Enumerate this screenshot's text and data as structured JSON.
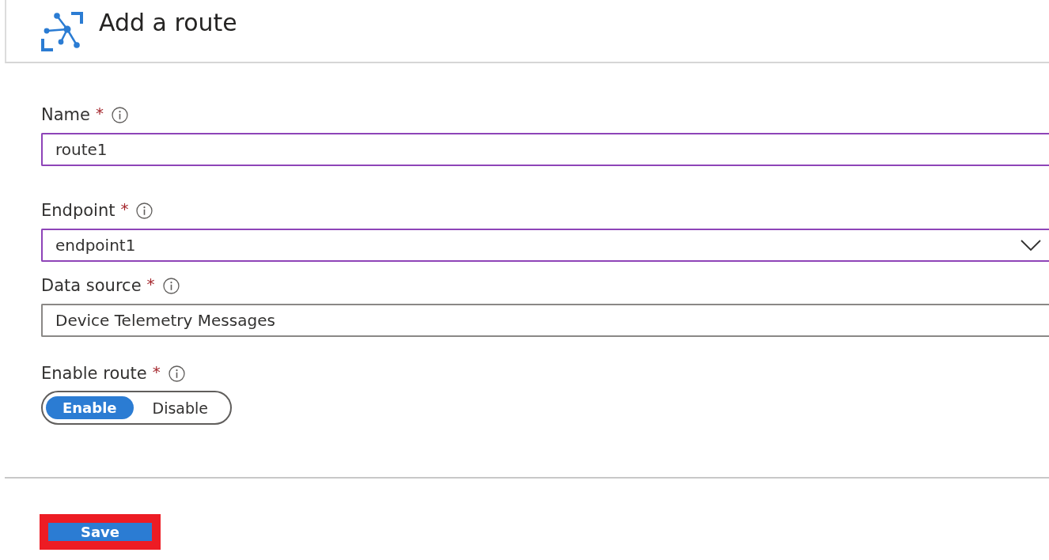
{
  "header": {
    "title": "Add a route"
  },
  "fields": [
    {
      "kind": "text",
      "label": "Name",
      "required_mark": "*",
      "value": "route1",
      "highlighted": true
    },
    {
      "kind": "dropdown",
      "label": "Endpoint",
      "required_mark": "*",
      "value": "endpoint1",
      "highlighted": true
    },
    {
      "kind": "text",
      "label": "Data source",
      "required_mark": "*",
      "value": "Device Telemetry Messages",
      "highlighted": false
    },
    {
      "kind": "toggle",
      "label": "Enable route",
      "required_mark": "*",
      "options": [
        {
          "label": "Enable",
          "selected": true
        },
        {
          "label": "Disable",
          "selected": false
        }
      ]
    }
  ],
  "save_button": {
    "label": "Save",
    "highlighted": true
  }
}
